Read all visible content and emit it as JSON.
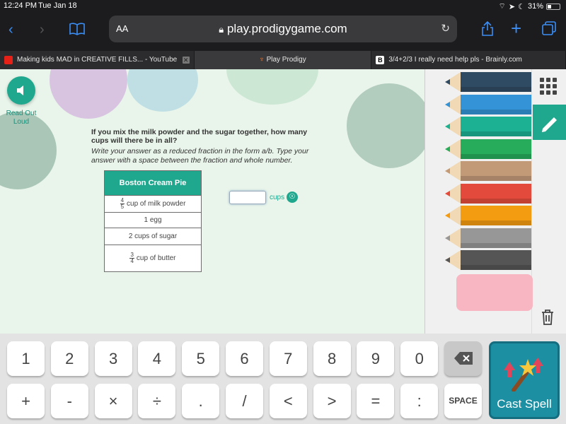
{
  "status": {
    "time": "12:24 PM",
    "date": "Tue Jan 18",
    "battery": "31%"
  },
  "toolbar": {
    "text_size_label": "AA",
    "url": "play.prodigygame.com"
  },
  "tabs": [
    {
      "label": "Making kids MAD in CREATIVE FILLS... - YouTube",
      "favicon_color": "#e62117"
    },
    {
      "label": "Play Prodigy",
      "favicon_color": "#ff7a2b"
    },
    {
      "label": "3/4+2/3 I really need help pls - Brainly.com",
      "favicon_color": "#ffffff"
    }
  ],
  "game": {
    "read_out_loud": "Read Out Loud",
    "question": "If you mix the milk powder and the sugar together, how many cups will there be in all?",
    "instructions": "Write your answer as a reduced fraction in the form a/b. Type your answer with a space between the fraction and whole number.",
    "recipe": {
      "title": "Boston Cream Pie",
      "rows": [
        {
          "numerator": "4",
          "denominator": "5",
          "text": "cup of milk powder"
        },
        {
          "text": "1 egg"
        },
        {
          "text": "2 cups of sugar"
        },
        {
          "numerator": "3",
          "denominator": "4",
          "text": "cup of butter"
        }
      ]
    },
    "answer_value": "",
    "unit_label": "cups"
  },
  "panel": {
    "pencil_colors": [
      "#2f4a63",
      "#3393d6",
      "#1cb193",
      "#27ac5c",
      "#c39a78",
      "#e44a3c",
      "#f39c12",
      "#979797",
      "#555555"
    ],
    "eraser_color": "#f7b6c1",
    "accent": "#1fa88e"
  },
  "keypad": {
    "row1": [
      "1",
      "2",
      "3",
      "4",
      "5",
      "6",
      "7",
      "8",
      "9",
      "0"
    ],
    "row2": [
      "+",
      "-",
      "×",
      "÷",
      ".",
      "/",
      "<",
      ">",
      "=",
      ":"
    ],
    "space_label": "SPACE",
    "cast_label": "Cast Spell"
  }
}
